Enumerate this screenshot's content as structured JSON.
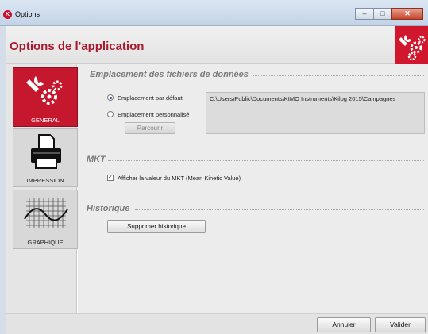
{
  "window": {
    "title": "Options",
    "app_icon": "kimo-logo-icon"
  },
  "header": {
    "title": "Options de l'application",
    "brand_color": "#d0172d"
  },
  "sidebar": {
    "items": [
      {
        "label": "GENERAL",
        "icon": "tools-gears-icon",
        "active": true
      },
      {
        "label": "IMPRESSION",
        "icon": "printer-icon",
        "active": false
      },
      {
        "label": "GRAPHIQUE",
        "icon": "graph-curve-icon",
        "active": false
      }
    ]
  },
  "sections": {
    "data_location": {
      "title": "Emplacement des fichiers de données",
      "default_label": "Emplacement par défaut",
      "custom_label": "Emplacement personnalisé",
      "selected": "default",
      "browse_label": "Parcourir",
      "path": "C:\\Users\\Public\\Documents\\KIMO Instruments\\Kilog 2015\\Campagnes"
    },
    "mkt": {
      "title": "MKT",
      "checkbox_label": "Afficher la valeur du MKT (Mean Kinetic Value)",
      "checked": true
    },
    "history": {
      "title": "Historique",
      "clear_label": "Supprimer historique"
    }
  },
  "footer": {
    "cancel_label": "Annuler",
    "ok_label": "Valider"
  }
}
